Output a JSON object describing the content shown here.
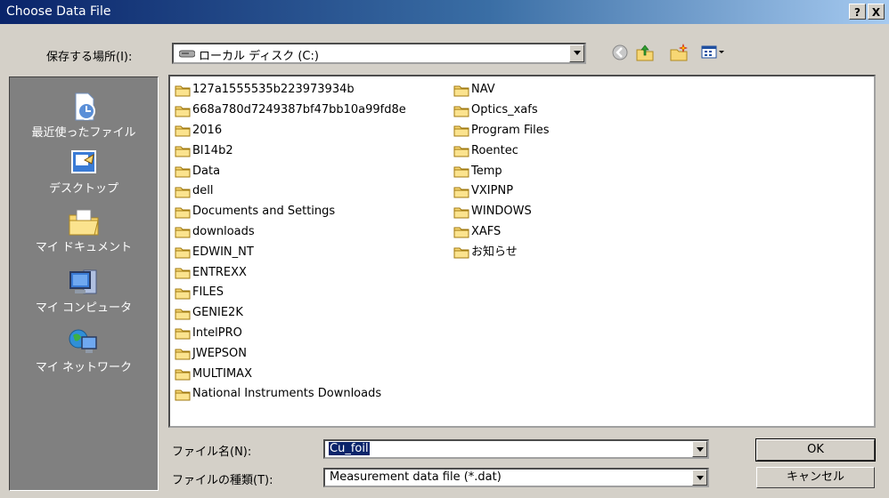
{
  "window": {
    "title": "Choose Data File",
    "help_label": "?",
    "close_label": "X"
  },
  "look_in": {
    "label": "保存する場所(I):",
    "value": "ローカル ディスク (C:)"
  },
  "places": [
    {
      "label": "最近使ったファイル",
      "icon": "recent-icon"
    },
    {
      "label": "デスクトップ",
      "icon": "desktop-icon"
    },
    {
      "label": "マイ ドキュメント",
      "icon": "my-documents-icon"
    },
    {
      "label": "マイ コンピュータ",
      "icon": "my-computer-icon"
    },
    {
      "label": "マイ ネットワーク",
      "icon": "my-network-icon"
    }
  ],
  "files": {
    "column1": [
      "127a1555535b223973934b",
      "668a780d7249387bf47bb10a99fd8e",
      "2016",
      "Bl14b2",
      "Data",
      "dell",
      "Documents and Settings",
      "downloads",
      "EDWIN_NT",
      "ENTREXX",
      "FILES",
      "GENIE2K",
      "IntelPRO",
      "JWEPSON",
      "MULTIMAX",
      "National Instruments Downloads"
    ],
    "column2": [
      "NAV",
      "Optics_xafs",
      "Program Files",
      "Roentec",
      "Temp",
      "VXIPNP",
      "WINDOWS",
      "XAFS",
      "お知らせ"
    ]
  },
  "filename": {
    "label": "ファイル名(N):",
    "value": "Cu_foil"
  },
  "filetype": {
    "label": "ファイルの種類(T):",
    "value": "Measurement data file (*.dat)"
  },
  "buttons": {
    "ok": "OK",
    "cancel": "キャンセル"
  },
  "colors": {
    "titlebar_start": "#0a246a",
    "titlebar_end": "#a6caf0",
    "folder": "#f7d774",
    "selection": "#0a246a"
  }
}
